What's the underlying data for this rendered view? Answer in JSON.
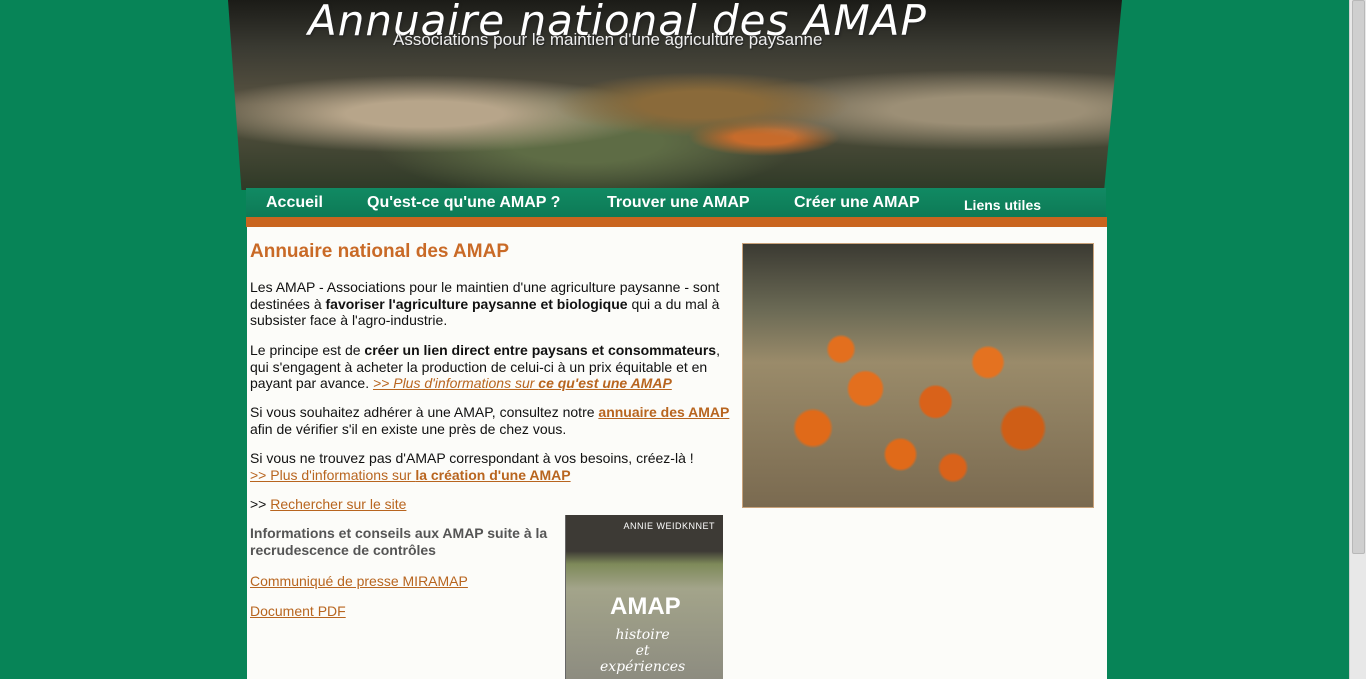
{
  "banner": {
    "title": "Annuaire national des AMAP",
    "subtitle": "Associations pour le maintien d'une agriculture paysanne"
  },
  "nav": {
    "items": [
      {
        "label": "Accueil"
      },
      {
        "label": "Qu'est-ce qu'une AMAP ?"
      },
      {
        "label": "Trouver une AMAP"
      },
      {
        "label": "Créer une AMAP"
      },
      {
        "label": "Liens utiles"
      }
    ]
  },
  "main": {
    "title": "Annuaire national des AMAP",
    "p1": {
      "pre": "Les AMAP - Associations pour le maintien d'une agriculture paysanne - sont destinées à ",
      "bold": "favoriser l'agriculture paysanne et biologique",
      "post": " qui a du mal à subsister face à l'agro-industrie."
    },
    "p2": {
      "pre": "Le principe est de ",
      "bold": "créer un lien direct entre paysans et consommateurs",
      "post": ", qui s'engagent à acheter la production de celui-ci à un prix équitable et en payant par avance. ",
      "link_pre": ">> Plus d'informations sur ",
      "link_bold": "ce qu'est une AMAP"
    },
    "p3": {
      "pre": "Si vous souhaitez adhérer à une AMAP, consultez notre ",
      "link": "annuaire des AMAP",
      "post": " afin de vérifier s'il en existe une près de chez vous."
    },
    "p4": {
      "text": "Si vous ne trouvez pas d'AMAP correspondant à vos besoins, créez-là !",
      "link_pre": ">> Plus d'informations sur ",
      "link_bold": "la création d'une AMAP"
    },
    "p5": {
      "pre": ">> ",
      "link": "Rechercher sur le site"
    },
    "info": {
      "title": "Informations et conseils aux AMAP suite à la recrudescence de contrôles",
      "link1": "Communiqué de presse MIRAMAP",
      "link2": "Document PDF"
    },
    "book": {
      "author": "ANNIE WEIDKNNET",
      "title": "AMAP",
      "subtitle_line1": "histoire",
      "subtitle_line2": "et",
      "subtitle_line3": "expériences"
    }
  },
  "colors": {
    "background": "#078457",
    "accent": "#c96a27",
    "nav": "#0d7a56"
  }
}
